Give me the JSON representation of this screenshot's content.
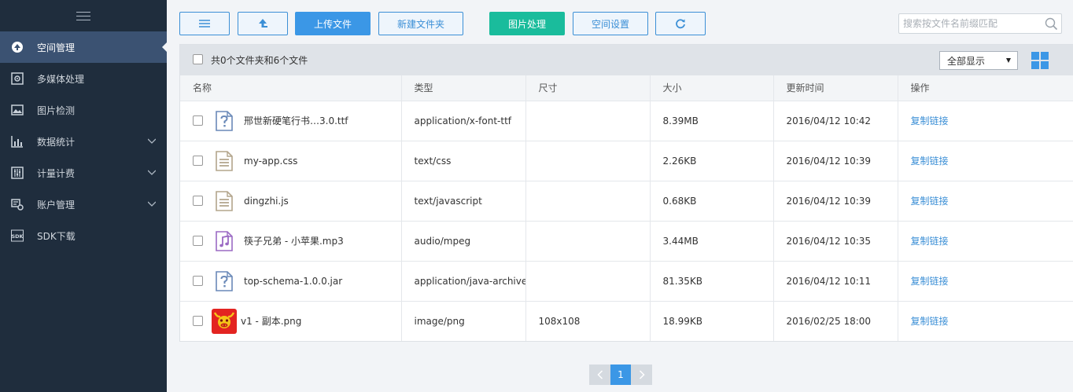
{
  "sidebar": {
    "items": [
      {
        "label": "空间管理",
        "active": true
      },
      {
        "label": "多媒体处理"
      },
      {
        "label": "图片检测"
      },
      {
        "label": "数据统计",
        "expandable": true
      },
      {
        "label": "计量计费",
        "expandable": true
      },
      {
        "label": "账户管理",
        "expandable": true
      },
      {
        "label": "SDK下载"
      }
    ]
  },
  "toolbar": {
    "upload_label": "上传文件",
    "new_folder_label": "新建文件夹",
    "image_process_label": "图片处理",
    "space_settings_label": "空间设置",
    "search_placeholder": "搜索按文件名前缀匹配"
  },
  "panel": {
    "count_text": "共0个文件夹和6个文件",
    "display_select": "全部显示"
  },
  "table": {
    "headers": [
      "名称",
      "类型",
      "尺寸",
      "大小",
      "更新时间",
      "操作"
    ],
    "rows": [
      {
        "name": "邢世新硬笔行书…3.0.ttf",
        "icon": "unknown-file-icon",
        "type": "application/x-font-ttf",
        "dims": "",
        "size": "8.39MB",
        "time": "2016/04/12 10:42",
        "action": "复制链接"
      },
      {
        "name": "my-app.css",
        "icon": "text-file-icon",
        "type": "text/css",
        "dims": "",
        "size": "2.26KB",
        "time": "2016/04/12 10:39",
        "action": "复制链接"
      },
      {
        "name": "dingzhi.js",
        "icon": "text-file-icon",
        "type": "text/javascript",
        "dims": "",
        "size": "0.68KB",
        "time": "2016/04/12 10:39",
        "action": "复制链接"
      },
      {
        "name": "筷子兄弟 - 小苹果.mp3",
        "icon": "music-file-icon",
        "type": "audio/mpeg",
        "dims": "",
        "size": "3.44MB",
        "time": "2016/04/12 10:35",
        "action": "复制链接"
      },
      {
        "name": "top-schema-1.0.0.jar",
        "icon": "unknown-file-icon",
        "type": "application/java-archive",
        "dims": "",
        "size": "81.35KB",
        "time": "2016/04/12 10:11",
        "action": "复制链接"
      },
      {
        "name": "v1 - 副本.png",
        "icon": "image-thumbnail",
        "type": "image/png",
        "dims": "108x108",
        "size": "18.99KB",
        "time": "2016/02/25 18:00",
        "action": "复制链接"
      }
    ]
  },
  "pager": {
    "current": "1"
  },
  "colors": {
    "sidebar_bg": "#1f2d3d",
    "sidebar_active": "#3b5272",
    "primary": "#3b97e6",
    "green": "#1abc9c",
    "link": "#3b8fd6"
  }
}
